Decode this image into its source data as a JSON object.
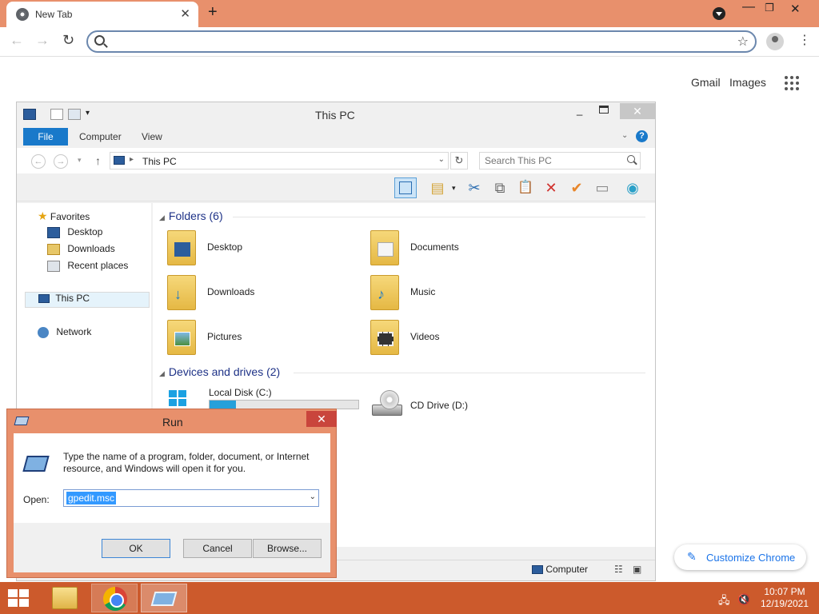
{
  "chrome": {
    "tab_title": "New Tab",
    "tab_close": "✕",
    "new_tab": "+",
    "win_min": "—",
    "win_max": "❐",
    "win_close": "✕",
    "back": "←",
    "forward": "→",
    "reload": "↻",
    "omnibox_value": "",
    "star": "☆",
    "menu": "⋮",
    "ntp": {
      "gmail": "Gmail",
      "images": "Images",
      "customize": "Customize Chrome",
      "customize_icon": "✎"
    }
  },
  "explorer": {
    "title": "This PC",
    "qat_dropdown": "▾",
    "close": "✕",
    "ribbon_tabs": [
      "File",
      "Computer",
      "View"
    ],
    "ribbon_chevron": "⌄",
    "help": "?",
    "back": "←",
    "forward": "→",
    "recent_dd": "▾",
    "up": "↑",
    "address": {
      "separator": "▸",
      "crumb": "This PC",
      "dropdown": "⌄",
      "refresh": "↻"
    },
    "search_placeholder": "Search This PC",
    "commands": {
      "cut": "✂",
      "copy": "⧉",
      "paste": "📋",
      "delete": "✕",
      "rename": "✔",
      "properties": "▭",
      "network": "◉"
    },
    "nav": {
      "favorites": "Favorites",
      "desktop": "Desktop",
      "downloads": "Downloads",
      "recent": "Recent places",
      "this_pc": "This PC",
      "network": "Network"
    },
    "folders_header": "Folders (6)",
    "folders": [
      "Desktop",
      "Documents",
      "Downloads",
      "Music",
      "Pictures",
      "Videos"
    ],
    "drives_header": "Devices and drives (2)",
    "drives": [
      {
        "name": "Local Disk (C:)",
        "used_fraction": 0.18
      },
      {
        "name": "CD Drive (D:)"
      }
    ],
    "status_computer": "Computer",
    "status_details": "☷",
    "status_tiles": "▣"
  },
  "run": {
    "title": "Run",
    "close": "✕",
    "description": "Type the name of a program, folder, document, or Internet resource, and Windows will open it for you.",
    "open_label": "Open:",
    "open_value": "gpedit.msc",
    "dropdown": "⌄",
    "ok": "OK",
    "cancel": "Cancel",
    "browse": "Browse..."
  },
  "taskbar": {
    "time": "10:07 PM",
    "date": "12/19/2021",
    "network_icon": "🖧",
    "volume_icon": "🔇"
  },
  "colors": {
    "accent": "#e8906c",
    "taskbar": "#cc5a2c",
    "explorer_file_tab": "#1979ca",
    "group_header": "#1e3287"
  }
}
